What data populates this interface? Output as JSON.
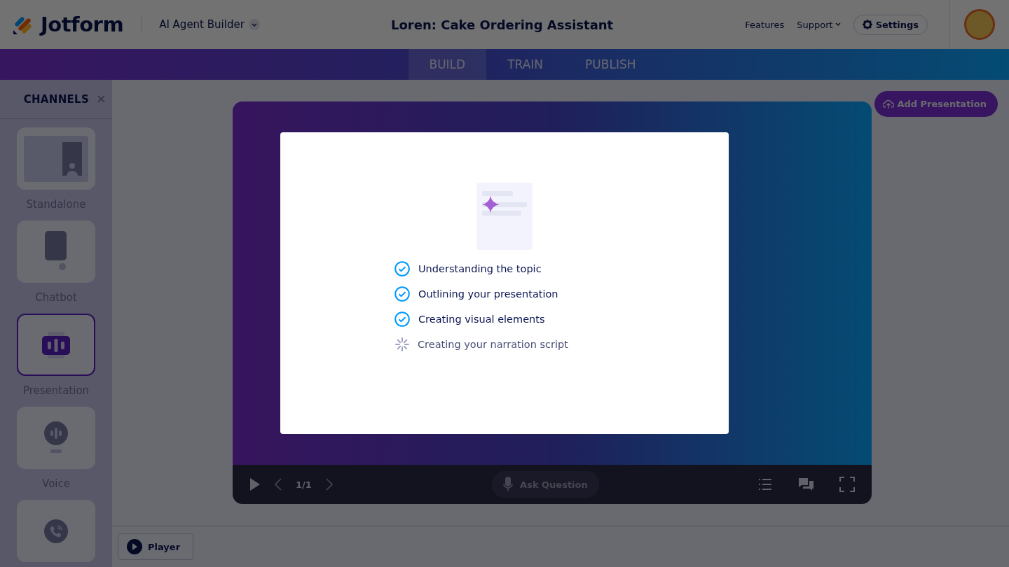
{
  "header": {
    "logo_text": "Jotform",
    "product": "AI Agent Builder",
    "title": "Loren: Cake Ordering Assistant",
    "nav": [
      "Features",
      "Support"
    ],
    "settings": "Settings"
  },
  "tabs": [
    {
      "label": "BUILD",
      "selected": true
    },
    {
      "label": "TRAIN",
      "selected": false
    },
    {
      "label": "PUBLISH",
      "selected": false
    }
  ],
  "sidebar": {
    "title": "CHANNELS",
    "channels": [
      {
        "kind": "standalone",
        "label": "Standalone",
        "selected": false
      },
      {
        "kind": "chatbot",
        "label": "Chatbot",
        "selected": false
      },
      {
        "kind": "presentation",
        "label": "Presentation",
        "selected": true
      },
      {
        "kind": "voice",
        "label": "Voice",
        "selected": false
      },
      {
        "kind": "phone",
        "selected": false
      }
    ]
  },
  "add_button": "Add Presentation",
  "player": {
    "page": "1/1",
    "ask": "Ask Question"
  },
  "bottom_bar": {
    "player_button": "Player"
  },
  "modal": {
    "steps": [
      {
        "label": "Understanding the topic",
        "done": true
      },
      {
        "label": "Outlining your presentation",
        "done": true
      },
      {
        "label": "Creating visual elements",
        "done": true
      },
      {
        "label": "Creating your narration script",
        "done": false
      }
    ]
  }
}
